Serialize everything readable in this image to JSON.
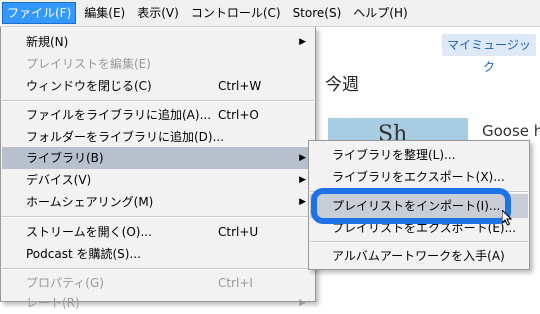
{
  "menubar": {
    "items": [
      {
        "label": "ファイル(F)"
      },
      {
        "label": "編集(E)"
      },
      {
        "label": "表示(V)"
      },
      {
        "label": "コントロール(C)"
      },
      {
        "label": "Store(S)"
      },
      {
        "label": "ヘルプ(H)"
      }
    ]
  },
  "background": {
    "my_music_button": "マイミュージック",
    "section_title": "今週",
    "album_art_text": "Sh",
    "album_title": "Goose h"
  },
  "file_menu": {
    "items": [
      {
        "label": "新規(N)",
        "shortcut": "",
        "submenu": true,
        "disabled": false
      },
      {
        "label": "プレイリストを編集(E)",
        "shortcut": "",
        "submenu": false,
        "disabled": true
      },
      {
        "label": "ウィンドウを閉じる(C)",
        "shortcut": "Ctrl+W",
        "submenu": false,
        "disabled": false
      },
      {
        "label": "ファイルをライブラリに追加(A)...",
        "shortcut": "Ctrl+O",
        "submenu": false,
        "disabled": false
      },
      {
        "label": "フォルダーをライブラリに追加(D)...",
        "shortcut": "",
        "submenu": false,
        "disabled": false
      },
      {
        "label": "ライブラリ(B)",
        "shortcut": "",
        "submenu": true,
        "disabled": false
      },
      {
        "label": "デバイス(V)",
        "shortcut": "",
        "submenu": true,
        "disabled": false
      },
      {
        "label": "ホームシェアリング(M)",
        "shortcut": "",
        "submenu": true,
        "disabled": false
      },
      {
        "label": "ストリームを開く(O)...",
        "shortcut": "Ctrl+U",
        "submenu": false,
        "disabled": false
      },
      {
        "label": "Podcast を購読(S)...",
        "shortcut": "",
        "submenu": false,
        "disabled": false
      },
      {
        "label": "プロパティ(G)",
        "shortcut": "Ctrl+I",
        "submenu": false,
        "disabled": true
      },
      {
        "label": "レート(R)",
        "shortcut": "",
        "submenu": true,
        "disabled": true
      }
    ]
  },
  "library_submenu": {
    "items": [
      {
        "label": "ライブラリを整理(L)..."
      },
      {
        "label": "ライブラリをエクスポート(X)..."
      },
      {
        "label": "プレイリストをインポート(I)..."
      },
      {
        "label": "プレイリストをエクスポート(E)..."
      },
      {
        "label": "アルバムアートワークを入手(A)"
      }
    ]
  },
  "colors": {
    "menubar_active": "#3399ff",
    "highlight": "#b8c0ce",
    "annotation": "#1f72e6"
  },
  "icons": {
    "submenu_arrow": "▶"
  }
}
